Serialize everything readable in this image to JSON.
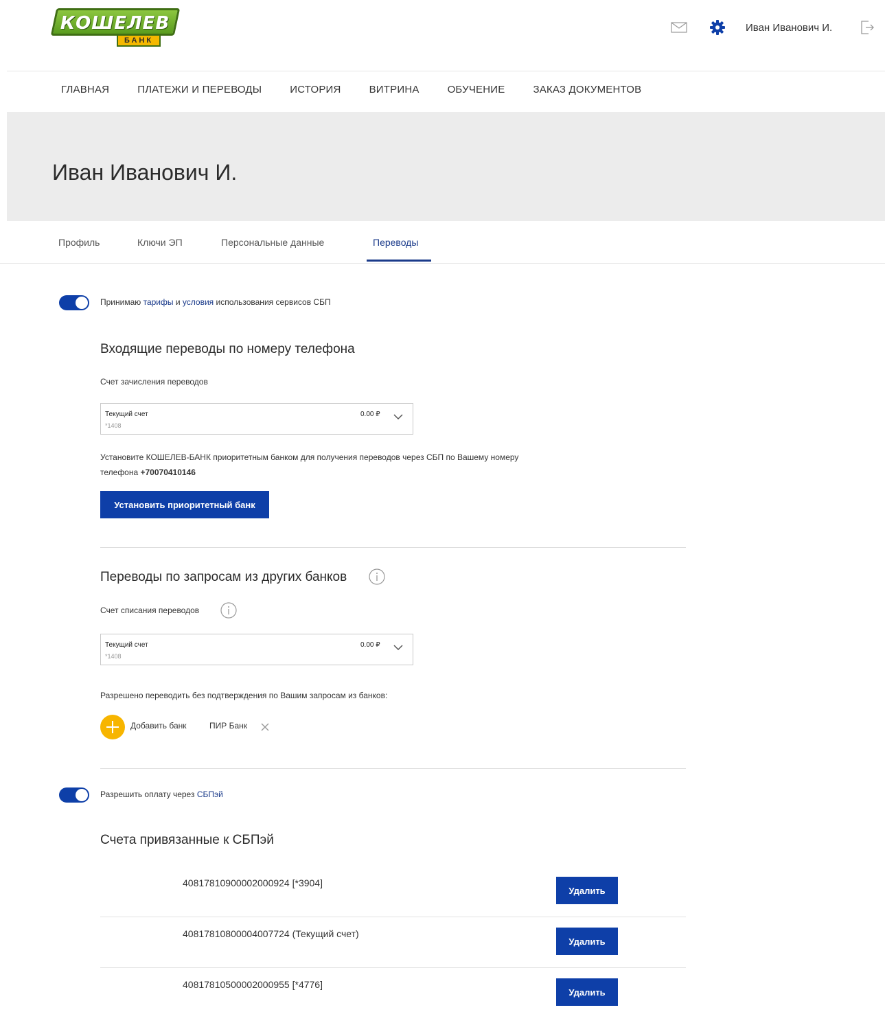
{
  "header": {
    "logo_top": "КОШЕЛЕВ",
    "logo_bottom": "БАНК",
    "user_name": "Иван Иванович И.",
    "icons": [
      "mail-icon",
      "gear-icon",
      "logout-icon"
    ]
  },
  "nav": {
    "items": [
      "ГЛАВНАЯ",
      "ПЛАТЕЖИ И ПЕРЕВОДЫ",
      "ИСТОРИЯ",
      "ВИТРИНА",
      "ОБУЧЕНИЕ",
      "ЗАКАЗ ДОКУМЕНТОВ"
    ]
  },
  "banner": {
    "title": "Иван Иванович И."
  },
  "tabs": {
    "items": [
      "Профиль",
      "Ключи ЭП",
      "Персональные данные",
      "Переводы"
    ],
    "active": "Переводы"
  },
  "sbp_toggle": {
    "on": true,
    "text_before": "Принимаю ",
    "link1": "тарифы",
    "text_mid": " и ",
    "link2": "условия",
    "text_after": " использования сервисов СБП"
  },
  "incoming": {
    "title": "Входящие переводы по номеру телефона",
    "account_label": "Счет зачисления переводов",
    "select": {
      "name": "Текущий счет",
      "number": "*1408",
      "amount": "0.00 ₽"
    },
    "hint_line1": "Установите КОШЕЛЕВ-БАНК приоритетным банком для получения переводов через СБП по Вашему номеру",
    "hint_line2_prefix": "телефона ",
    "phone": "+70070410146",
    "button": "Установить приоритетный банк"
  },
  "requests": {
    "title": "Переводы по запросам из других банков",
    "account_label": "Счет списания переводов",
    "select": {
      "name": "Текущий счет",
      "number": "*1408",
      "amount": "0.00 ₽"
    },
    "allowed_label": "Разрешено переводить без подтверждения по Вашим запросам из банков:",
    "add_bank": "Добавить банк",
    "bank_chip": "ПИР Банк"
  },
  "sbpay_toggle": {
    "on": true,
    "text_before": "Разрешить оплату через ",
    "link": "СБПэй"
  },
  "sbpay_accounts": {
    "title": "Счета привязанные к СБПэй",
    "rows": [
      {
        "number": "40817810900002000924 [*3904]",
        "button": "Удалить"
      },
      {
        "number": "40817810800004007724 (Текущий счет)",
        "button": "Удалить"
      },
      {
        "number": "40817810500002000955 [*4776]",
        "button": "Удалить"
      }
    ]
  },
  "colors": {
    "primary": "#0e3fa8",
    "accent_yellow": "#f7b500",
    "banner_bg": "#ececec",
    "logo_green": "#6cab2a"
  }
}
